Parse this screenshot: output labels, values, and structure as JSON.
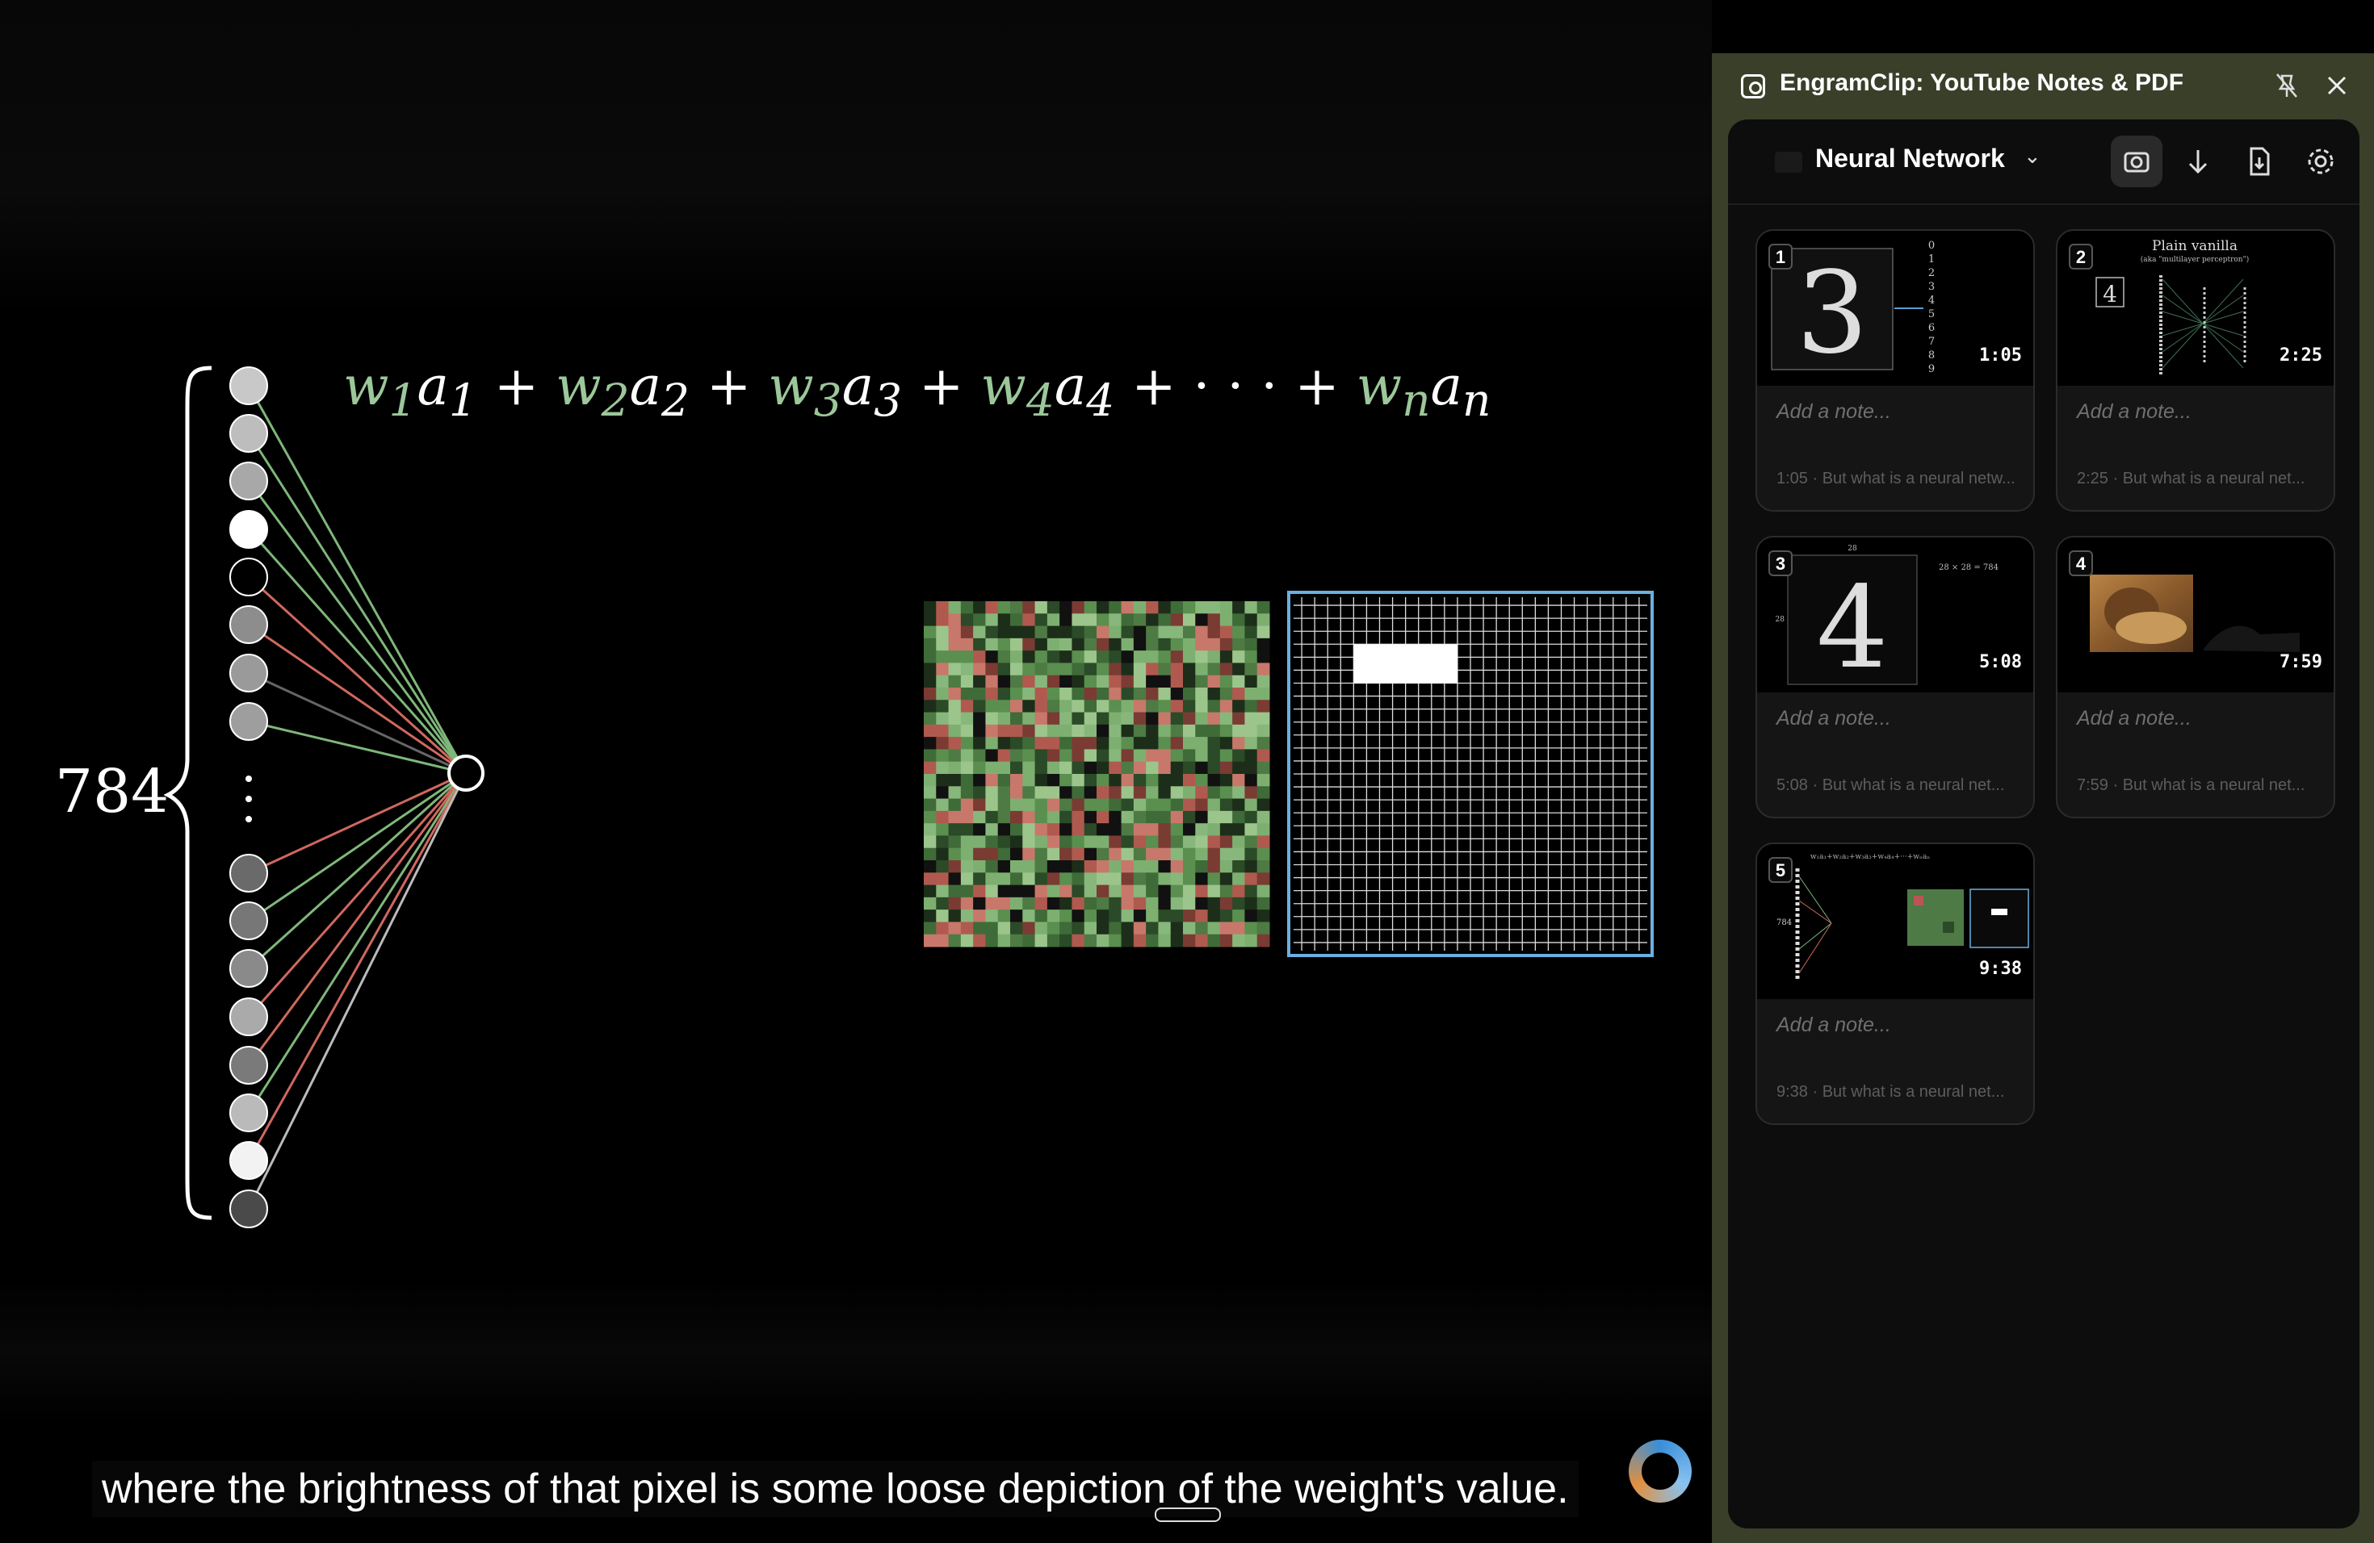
{
  "video": {
    "equation_terms": [
      {
        "w": "w",
        "wsub": "1",
        "a": "a",
        "asub": "1"
      },
      {
        "w": "w",
        "wsub": "2",
        "a": "a",
        "asub": "2"
      },
      {
        "w": "w",
        "wsub": "3",
        "a": "a",
        "asub": "3"
      },
      {
        "w": "w",
        "wsub": "4",
        "a": "a",
        "asub": "4"
      },
      {
        "w": "w",
        "wsub": "n",
        "a": "a",
        "asub": "n"
      }
    ],
    "input_count": "784",
    "subtitle": "where the brightness of that pixel is some loose depiction of the weight's value."
  },
  "panel": {
    "title": "EngramClip: YouTube Notes & PDF",
    "project_name": "Neural Network",
    "icons": {
      "app": "camera-frame-icon",
      "pin": "unpin-icon",
      "close": "close-icon",
      "screenshot": "camera-icon",
      "download": "arrow-down-icon",
      "pdf": "pdf-export-icon",
      "settings": "gear-icon"
    }
  },
  "cards": [
    {
      "index": "1",
      "time": "1:05",
      "note_placeholder": "Add a note...",
      "meta": "1:05 · But what is a neural netw..."
    },
    {
      "index": "2",
      "time": "2:25",
      "note_placeholder": "Add a note...",
      "meta": "2:25 · But what is a neural net...",
      "thumb_title": "Plain vanilla",
      "thumb_subtitle": "(aka \"multilayer perceptron\")",
      "thumb_digit": "4"
    },
    {
      "index": "3",
      "time": "5:08",
      "note_placeholder": "Add a note...",
      "meta": "5:08 · But what is a neural net...",
      "thumb_dims": "28 × 28 = 784",
      "thumb_side": "28"
    },
    {
      "index": "4",
      "time": "7:59",
      "note_placeholder": "Add a note...",
      "meta": "7:59 · But what is a neural net..."
    },
    {
      "index": "5",
      "time": "9:38",
      "note_placeholder": "Add a note...",
      "meta": "9:38 · But what is a neural net..."
    }
  ],
  "colors": {
    "panel_frame": "#3a3f2a",
    "weight_positive": "#7fb77a",
    "weight_negative": "#d0685f",
    "highlight_border": "#6ab0e0"
  }
}
